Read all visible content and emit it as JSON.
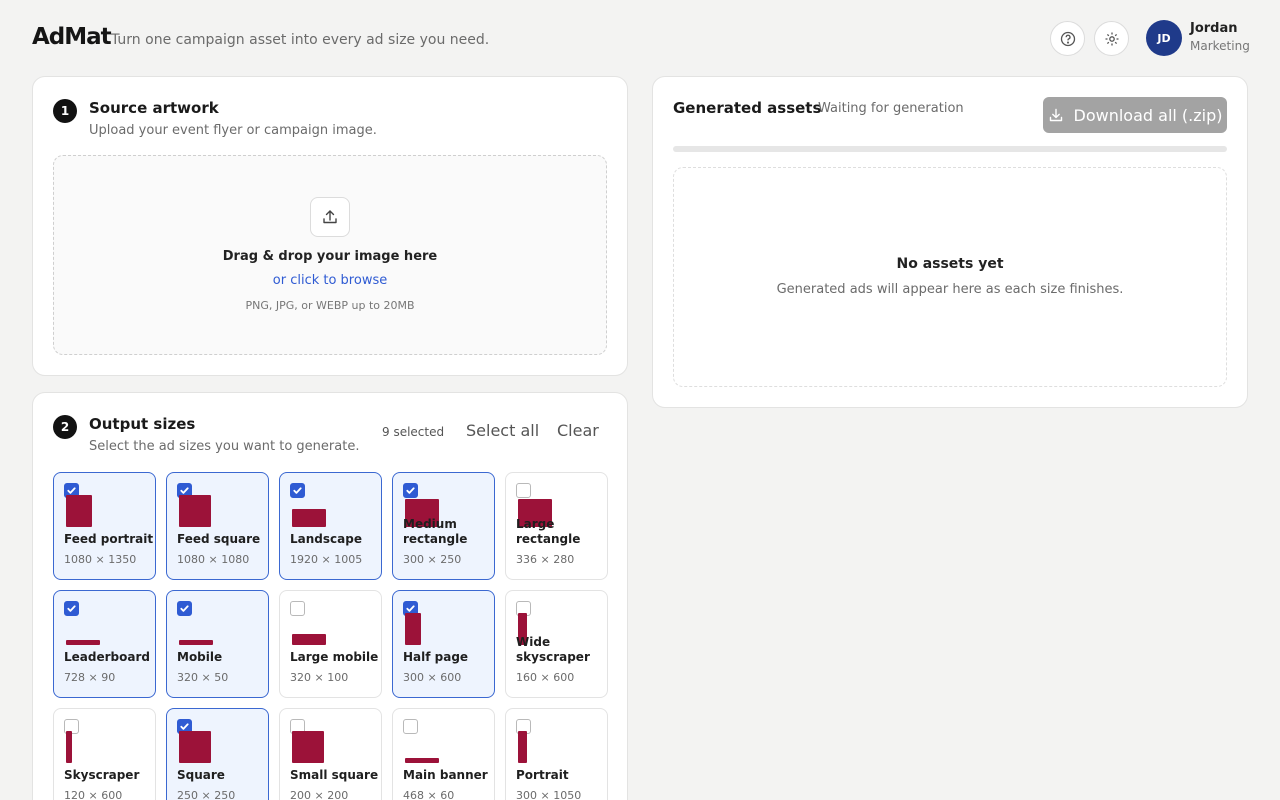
{
  "header": {
    "logo": "AdMat",
    "tagline": "Turn one campaign asset into every ad size you need.",
    "user": {
      "initials": "JD",
      "name": "Jordan",
      "role": "Marketing"
    },
    "icons": [
      "help-icon",
      "gear-icon"
    ]
  },
  "source": {
    "step": "1",
    "title": "Source artwork",
    "subtitle": "Upload your event flyer or campaign image.",
    "drop_title": "Drag & drop your image here",
    "browse": "or click to browse",
    "hint": "PNG, JPG, or WEBP up to 20MB"
  },
  "sizes": {
    "step": "2",
    "title": "Output sizes",
    "subtitle": "Select the ad sizes you want to generate.",
    "selected_count": "9 selected",
    "select_all": "Select all",
    "clear": "Clear",
    "items": [
      {
        "name": "Feed portrait",
        "dims": "1080 × 1350",
        "w": 1080,
        "h": 1350,
        "selected": true
      },
      {
        "name": "Feed square",
        "dims": "1080 × 1080",
        "w": 1080,
        "h": 1080,
        "selected": true
      },
      {
        "name": "Landscape",
        "dims": "1920 × 1005",
        "w": 1920,
        "h": 1005,
        "selected": true
      },
      {
        "name": "Medium rectangle",
        "dims": "300 × 250",
        "w": 300,
        "h": 250,
        "selected": true
      },
      {
        "name": "Large rectangle",
        "dims": "336 × 280",
        "w": 336,
        "h": 280,
        "selected": false
      },
      {
        "name": "Leaderboard",
        "dims": "728 × 90",
        "w": 728,
        "h": 90,
        "selected": true
      },
      {
        "name": "Mobile",
        "dims": "320 × 50",
        "w": 320,
        "h": 50,
        "selected": true
      },
      {
        "name": "Large mobile",
        "dims": "320 × 100",
        "w": 320,
        "h": 100,
        "selected": false
      },
      {
        "name": "Half page",
        "dims": "300 × 600",
        "w": 300,
        "h": 600,
        "selected": true
      },
      {
        "name": "Wide skyscraper",
        "dims": "160 × 600",
        "w": 160,
        "h": 600,
        "selected": false
      },
      {
        "name": "Skyscraper",
        "dims": "120 × 600",
        "w": 120,
        "h": 600,
        "selected": false
      },
      {
        "name": "Square",
        "dims": "250 × 250",
        "w": 250,
        "h": 250,
        "selected": true
      },
      {
        "name": "Small square",
        "dims": "200 × 200",
        "w": 200,
        "h": 200,
        "selected": false
      },
      {
        "name": "Main banner",
        "dims": "468 × 60",
        "w": 468,
        "h": 60,
        "selected": false
      },
      {
        "name": "Portrait",
        "dims": "300 × 1050",
        "w": 300,
        "h": 1050,
        "selected": false
      }
    ]
  },
  "generated": {
    "title": "Generated assets",
    "status": "Waiting for generation",
    "download_label": "Download all (.zip)",
    "progress": 0,
    "empty_title": "No assets yet",
    "empty_subtitle": "Generated ads will appear here as each size finishes."
  },
  "colors": {
    "accent": "#2f5bd3",
    "swatch": "#9c1239",
    "avatar": "#1f3a8a"
  }
}
